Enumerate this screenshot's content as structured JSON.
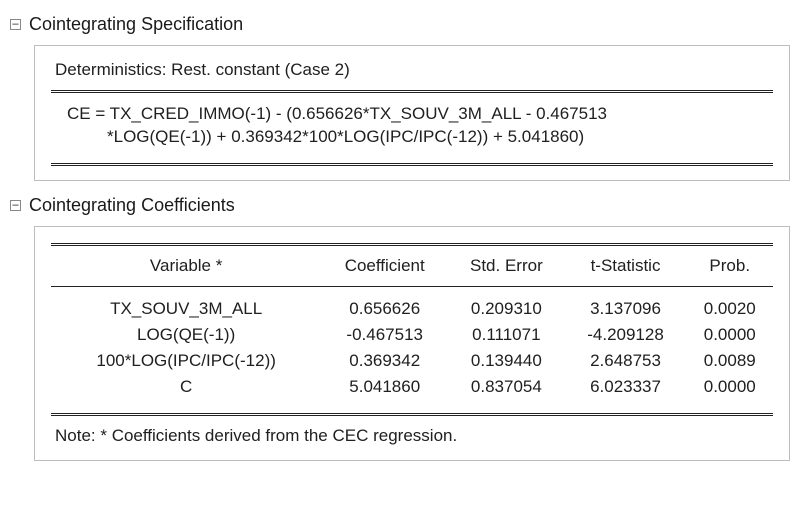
{
  "sections": {
    "spec": {
      "toggle": "−",
      "title": "Cointegrating Specification",
      "deterministics": "Deterministics: Rest. constant (Case 2)",
      "equation_l1": "CE = TX_CRED_IMMO(-1) - (0.656626*TX_SOUV_3M_ALL - 0.467513",
      "equation_l2": "*LOG(QE(-1)) + 0.369342*100*LOG(IPC/IPC(-12)) + 5.041860)"
    },
    "coef": {
      "toggle": "−",
      "title": "Cointegrating Coefficients",
      "headers": {
        "variable": "Variable *",
        "coefficient": "Coefficient",
        "stderr": "Std. Error",
        "tstat": "t-Statistic",
        "prob": "Prob."
      },
      "rows": [
        {
          "variable": "TX_SOUV_3M_ALL",
          "coefficient": "0.656626",
          "stderr": "0.209310",
          "tstat": "3.137096",
          "prob": "0.0020"
        },
        {
          "variable": "LOG(QE(-1))",
          "coefficient": "-0.467513",
          "stderr": "0.111071",
          "tstat": "-4.209128",
          "prob": "0.0000"
        },
        {
          "variable": "100*LOG(IPC/IPC(-12))",
          "coefficient": "0.369342",
          "stderr": "0.139440",
          "tstat": "2.648753",
          "prob": "0.0089"
        },
        {
          "variable": "C",
          "coefficient": "5.041860",
          "stderr": "0.837054",
          "tstat": "6.023337",
          "prob": "0.0000"
        }
      ],
      "note": "Note: * Coefficients derived from the CEC regression."
    }
  },
  "chart_data": {
    "type": "table",
    "title": "Cointegrating Coefficients",
    "columns": [
      "Variable",
      "Coefficient",
      "Std. Error",
      "t-Statistic",
      "Prob."
    ],
    "rows": [
      [
        "TX_SOUV_3M_ALL",
        0.656626,
        0.20931,
        3.137096,
        0.002
      ],
      [
        "LOG(QE(-1))",
        -0.467513,
        0.111071,
        -4.209128,
        0.0
      ],
      [
        "100*LOG(IPC/IPC(-12))",
        0.369342,
        0.13944,
        2.648753,
        0.0089
      ],
      [
        "C",
        5.04186,
        0.837054,
        6.023337,
        0.0
      ]
    ]
  }
}
